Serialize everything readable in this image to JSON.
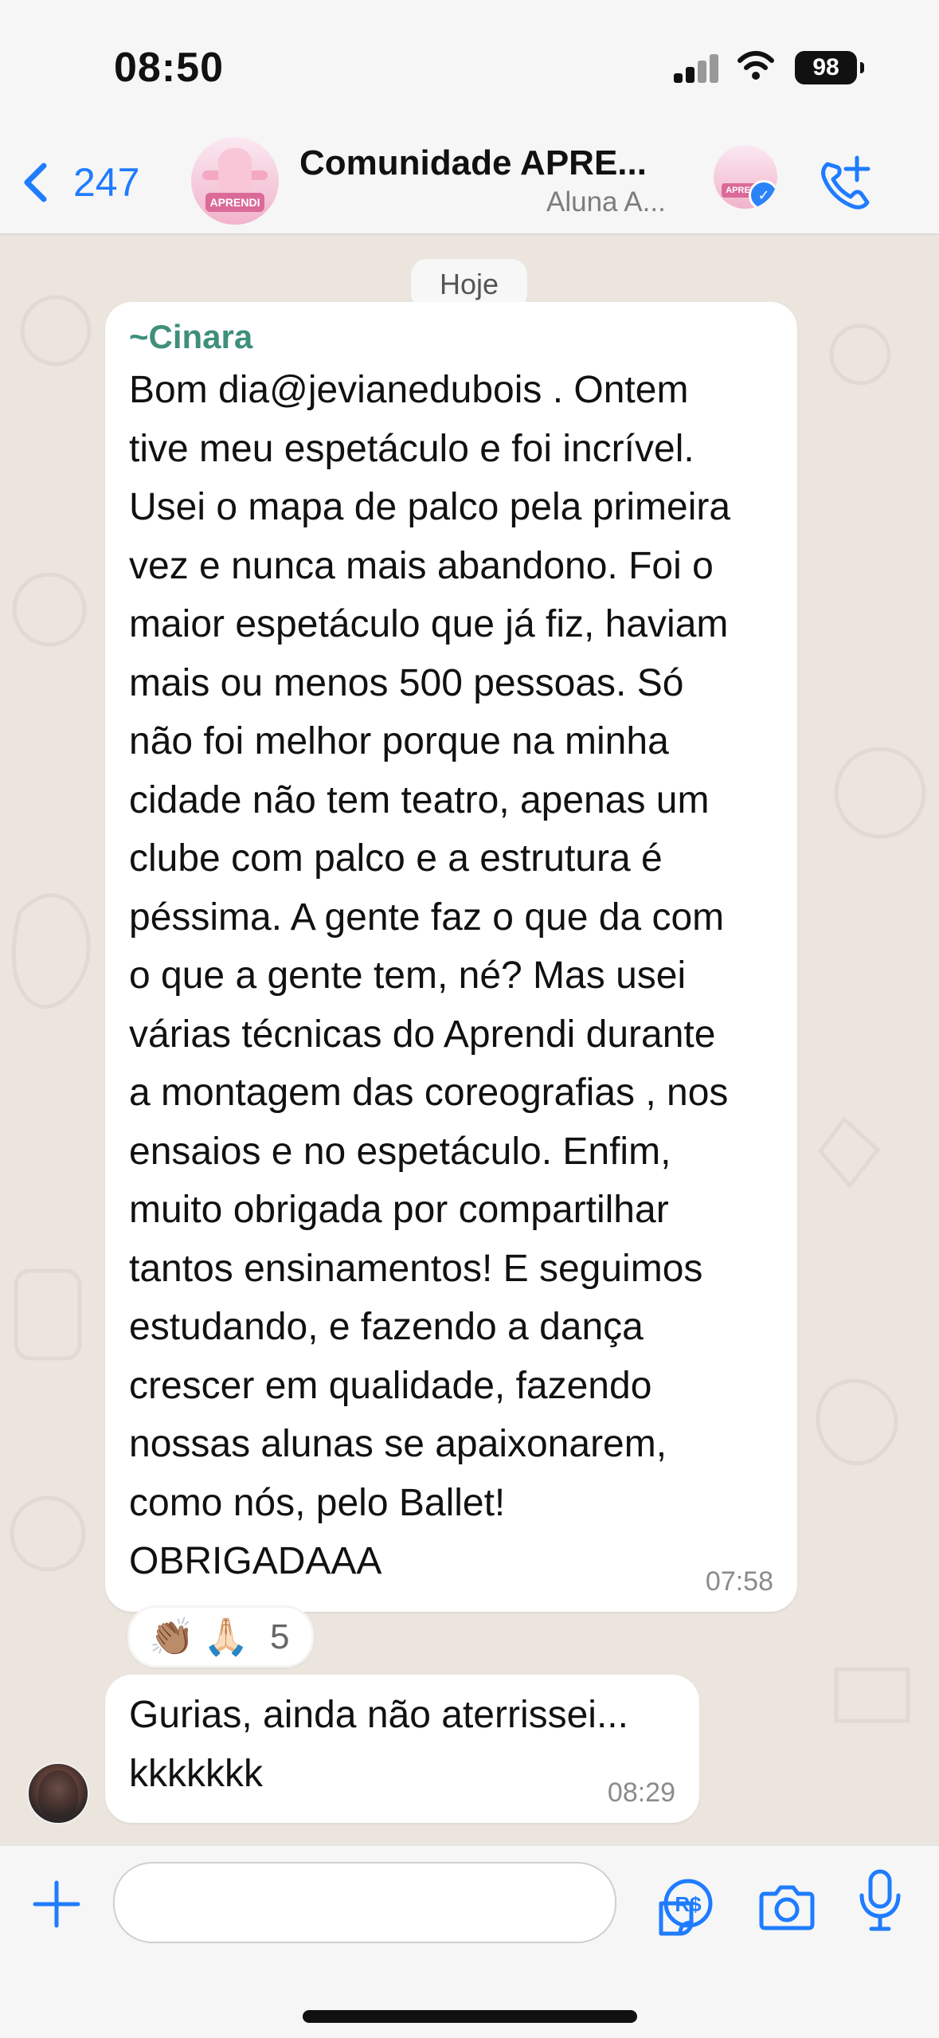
{
  "status_bar": {
    "time": "08:50",
    "battery": "98"
  },
  "header": {
    "back_count": "247",
    "title": "Comunidade APRE...",
    "subtitle": "Aluna A...",
    "avatar_logo": "APRENDI",
    "icons": [
      "back-chevron-icon",
      "verified-icon",
      "add-call-icon"
    ]
  },
  "chat": {
    "date_label": "Hoje",
    "messages": [
      {
        "sender": "~Cinara",
        "text": "Bom dia@jevianedubois . Ontem\ntive meu espetáculo e foi incrível.\nUsei o mapa de palco pela primeira\nvez e nunca mais abandono. Foi o\nmaior espetáculo que já fiz, haviam\nmais ou menos 500 pessoas. Só\nnão foi melhor porque na minha\ncidade  não tem teatro, apenas um\nclube com palco e a estrutura é\npéssima. A gente faz o que da com\no que a gente tem, né?  Mas usei\nvárias técnicas  do Aprendi durante\na montagem das coreografias , nos\nensaios e no espetáculo. Enfim,\nmuito obrigada  por compartilhar\ntantos ensinamentos! E seguimos\nestudando, e fazendo a dança\ncrescer em qualidade, fazendo\nnossas alunas se apaixonarem,\ncomo nós, pelo Ballet!\nOBRIGADAAA",
        "time": "07:58",
        "reactions": {
          "emoji_1": "👏🏽",
          "emoji_2": "🙏🏻",
          "count": "5"
        }
      },
      {
        "text": "Gurias, ainda não aterrissei...\nkkkkkkk",
        "time": "08:29"
      }
    ]
  },
  "composer": {
    "icons": [
      "plus-icon",
      "sticker-icon",
      "pix-cash-icon",
      "camera-icon",
      "microphone-icon"
    ]
  },
  "colors": {
    "accent": "#1f7cff",
    "sender_name": "#3f8f7a",
    "chat_background": "#ebe5de",
    "bubble": "#ffffff"
  }
}
